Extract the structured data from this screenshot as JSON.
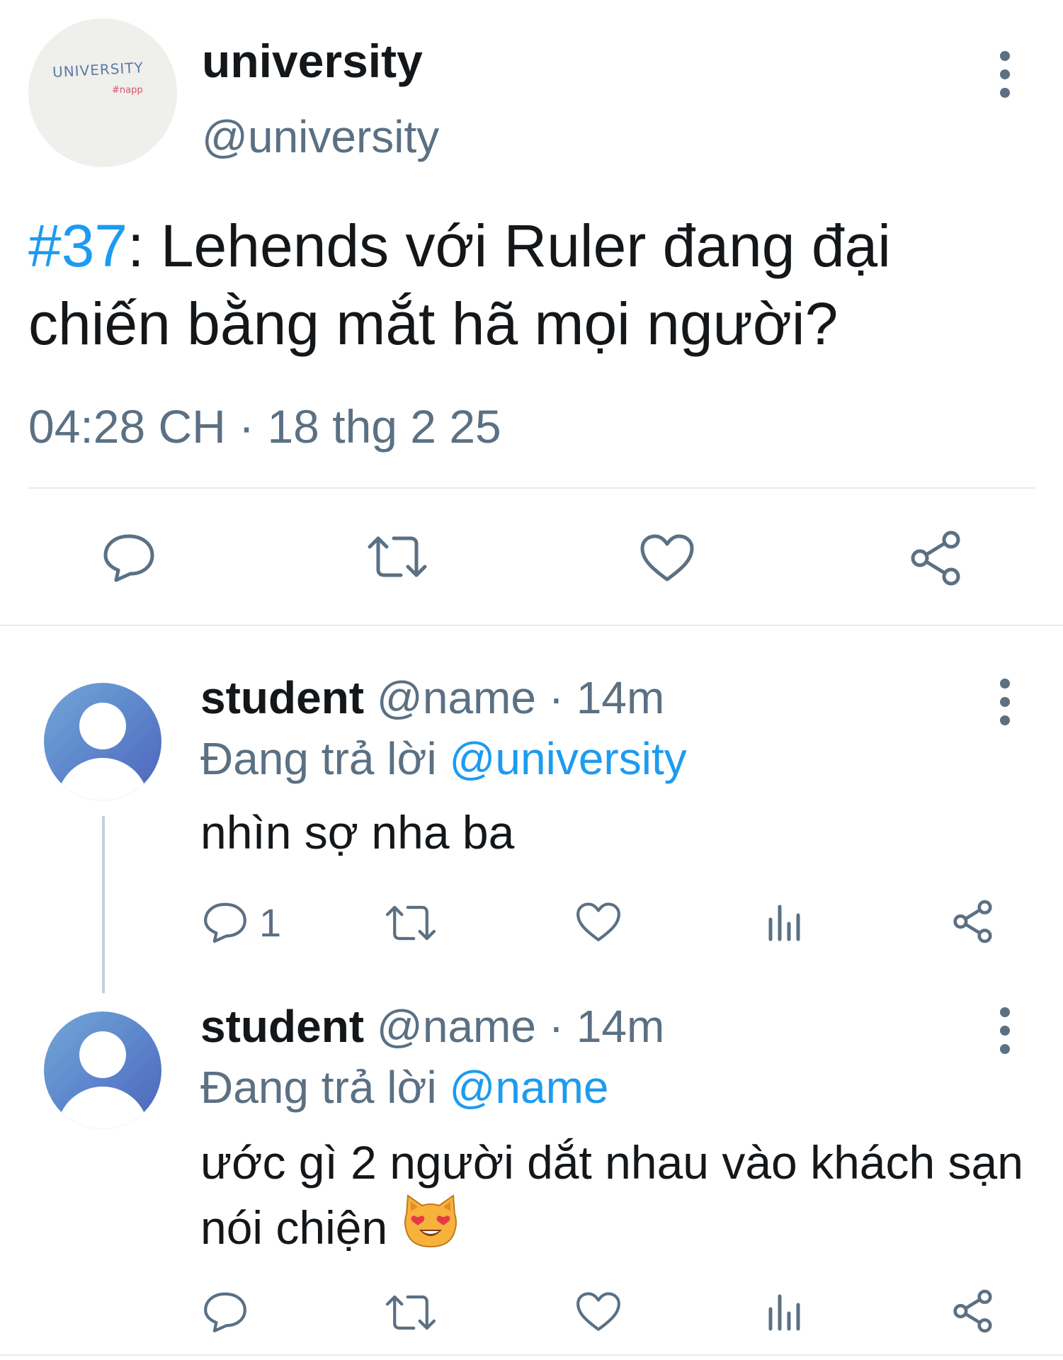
{
  "main_tweet": {
    "avatar_logo_text": "UNIVERSITY",
    "avatar_logo_sub": "#napp",
    "display_name": "university",
    "handle": "@university",
    "hashtag": "#37",
    "text": ": Lehends với Ruler đang đại chiến bằng mắt hã mọi người?",
    "timestamp": "04:28 CH · 18 thg 2 25",
    "actions": [
      "reply-icon",
      "retweet-icon",
      "like-icon",
      "share-icon"
    ]
  },
  "replies": [
    {
      "name": "student",
      "handle": "@name",
      "time": "· 14m",
      "replying_prefix": "Đang trả lời",
      "replying_to": "@university",
      "text": "nhìn sợ nha ba",
      "reply_count": "1",
      "actions": [
        "reply-icon",
        "retweet-icon",
        "like-icon",
        "analytics-icon",
        "share-icon"
      ]
    },
    {
      "name": "student",
      "handle": "@name",
      "time": "· 14m",
      "replying_prefix": "Đang trả lời",
      "replying_to": "@name",
      "text": "ước gì 2 người dắt nhau vào khách sạn nói chiện",
      "emoji": "smiling-cat-heart-eyes",
      "actions": [
        "reply-icon",
        "retweet-icon",
        "like-icon",
        "analytics-icon",
        "share-icon"
      ]
    }
  ],
  "colors": {
    "accent": "#1d9bf0",
    "secondary_text": "#5b7083",
    "primary_text": "#14171a",
    "divider": "#e6ecf0"
  }
}
